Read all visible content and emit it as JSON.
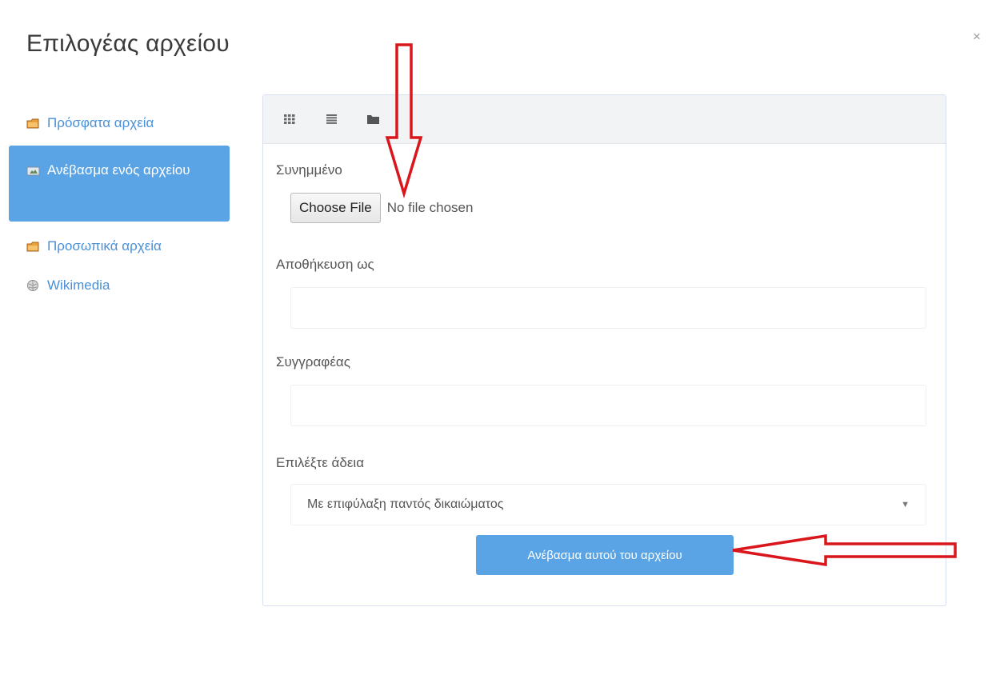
{
  "dialog": {
    "title": "Επιλογέας αρχείου",
    "close_label": "×"
  },
  "sidebar": {
    "items": [
      {
        "label": "Πρόσφατα αρχεία",
        "icon": "folder-icon",
        "active": false
      },
      {
        "label": "Ανέβασμα ενός αρχείου",
        "icon": "upload-icon",
        "active": true
      },
      {
        "label": "Προσωπικά αρχεία",
        "icon": "folder-icon",
        "active": false
      },
      {
        "label": "Wikimedia",
        "icon": "wikimedia-icon",
        "active": false
      }
    ]
  },
  "toolbar": {
    "buttons": [
      {
        "icon": "grid-view-icon"
      },
      {
        "icon": "list-view-icon"
      },
      {
        "icon": "folder-view-icon"
      }
    ]
  },
  "form": {
    "attachment_label": "Συνημμένο",
    "choose_file_label": "Choose File",
    "no_file_text": "No file chosen",
    "save_as_label": "Αποθήκευση ως",
    "save_as_value": "",
    "author_label": "Συγγραφέας",
    "author_value": "",
    "license_label": "Επιλέξτε άδεια",
    "license_selected": "Με επιφύλαξη παντός δικαιώματος",
    "upload_button_label": "Ανέβασμα αυτού του αρχείου"
  },
  "colors": {
    "accent": "#5aa4e6",
    "link": "#4a90d9",
    "annotation_arrow": "#d9161c",
    "toolbar_bg": "#f2f3f5"
  }
}
